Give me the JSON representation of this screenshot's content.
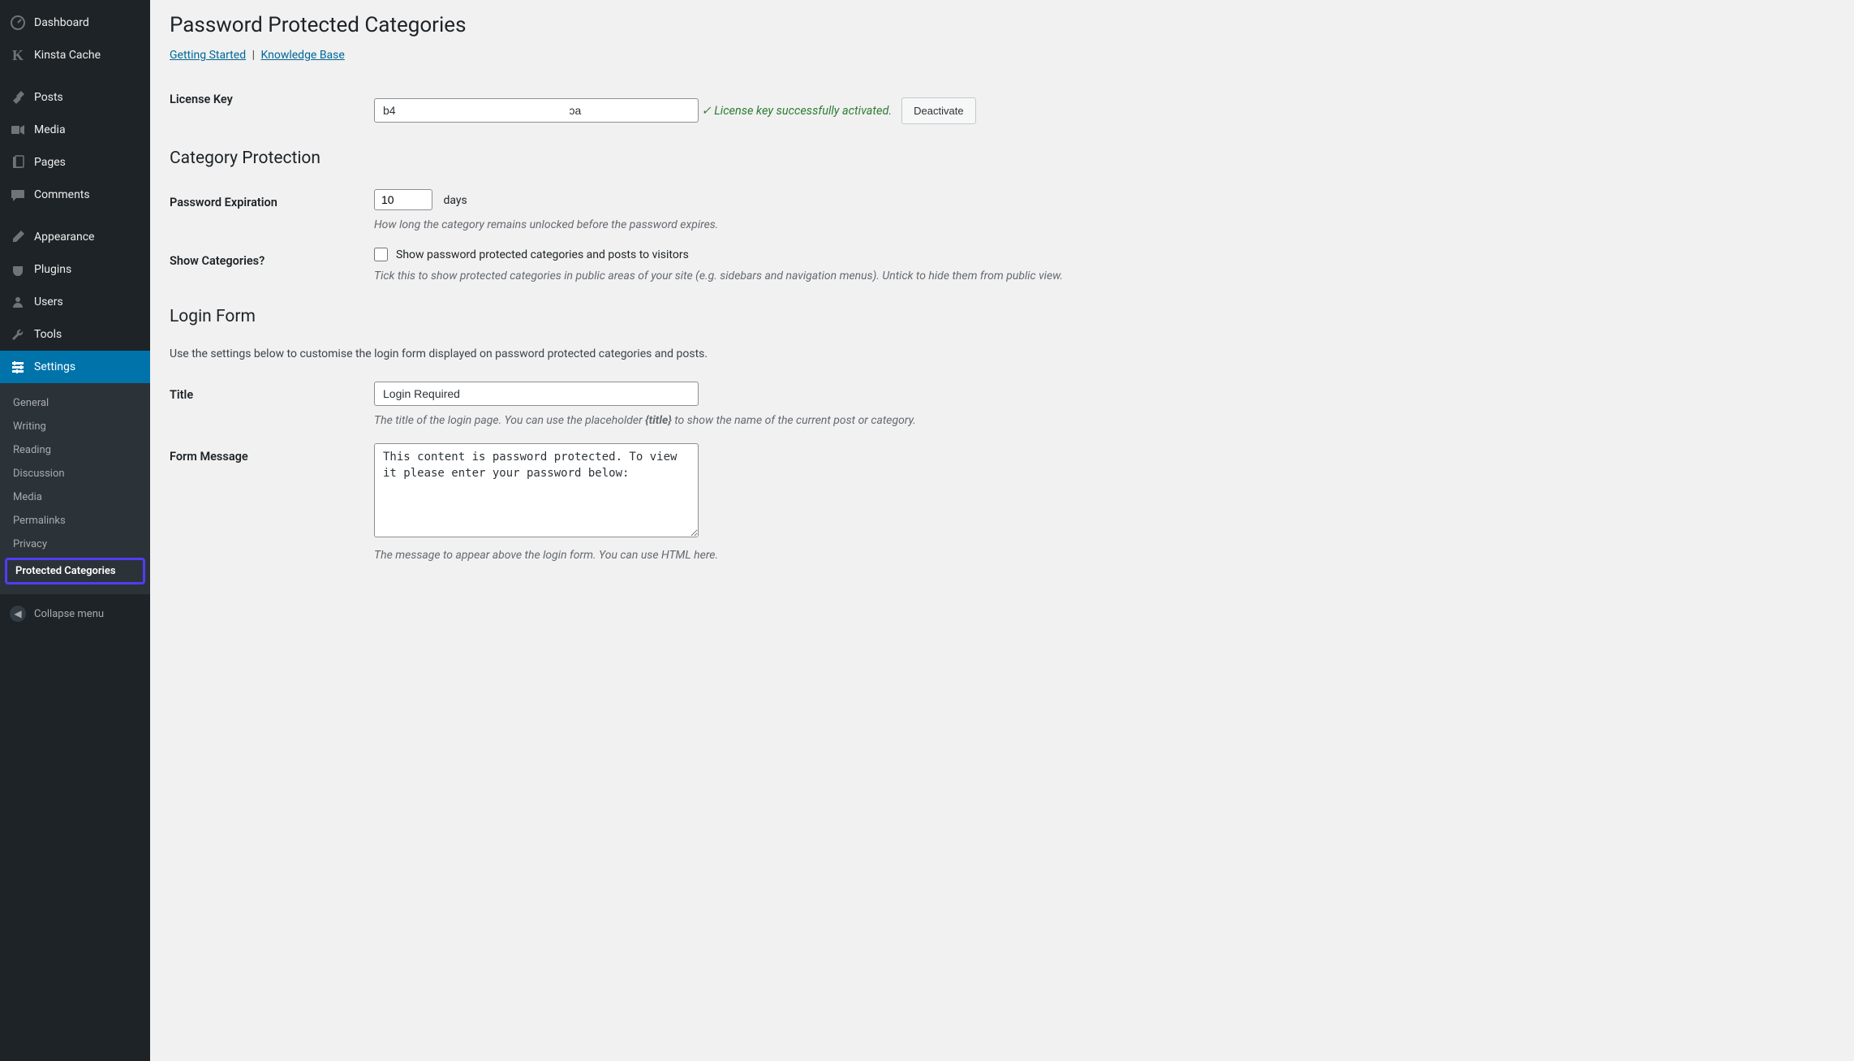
{
  "sidebar": {
    "items": [
      {
        "label": "Dashboard",
        "icon": "dashboard"
      },
      {
        "label": "Kinsta Cache",
        "icon": "k"
      },
      {
        "label": "Posts",
        "icon": "pin"
      },
      {
        "label": "Media",
        "icon": "media"
      },
      {
        "label": "Pages",
        "icon": "pages"
      },
      {
        "label": "Comments",
        "icon": "comments"
      },
      {
        "label": "Appearance",
        "icon": "brush"
      },
      {
        "label": "Plugins",
        "icon": "plug"
      },
      {
        "label": "Users",
        "icon": "users"
      },
      {
        "label": "Tools",
        "icon": "wrench"
      },
      {
        "label": "Settings",
        "icon": "settings"
      }
    ],
    "submenu": [
      "General",
      "Writing",
      "Reading",
      "Discussion",
      "Media",
      "Permalinks",
      "Privacy",
      "Protected Categories"
    ],
    "collapse": "Collapse menu"
  },
  "page": {
    "title": "Password Protected Categories",
    "links": {
      "getting_started": "Getting Started",
      "knowledge_base": "Knowledge Base"
    }
  },
  "license": {
    "label": "License Key",
    "value": "b4                                                       ɔa",
    "status": "✓ License key successfully activated.",
    "deactivate": "Deactivate"
  },
  "category_protection": {
    "heading": "Category Protection",
    "password_expiration": {
      "label": "Password Expiration",
      "value": "10",
      "unit": "days",
      "desc": "How long the category remains unlocked before the password expires."
    },
    "show_categories": {
      "label": "Show Categories?",
      "checkbox_label": "Show password protected categories and posts to visitors",
      "desc": "Tick this to show protected categories in public areas of your site (e.g. sidebars and navigation menus). Untick to hide them from public view."
    }
  },
  "login_form": {
    "heading": "Login Form",
    "desc": "Use the settings below to customise the login form displayed on password protected categories and posts.",
    "title_field": {
      "label": "Title",
      "value": "Login Required",
      "desc_pre": "The title of the login page. You can use the placeholder ",
      "desc_bold": "{title}",
      "desc_post": " to show the name of the current post or category."
    },
    "form_message": {
      "label": "Form Message",
      "value": "This content is password protected. To view it please enter your password below:",
      "desc": "The message to appear above the login form. You can use HTML here."
    }
  }
}
